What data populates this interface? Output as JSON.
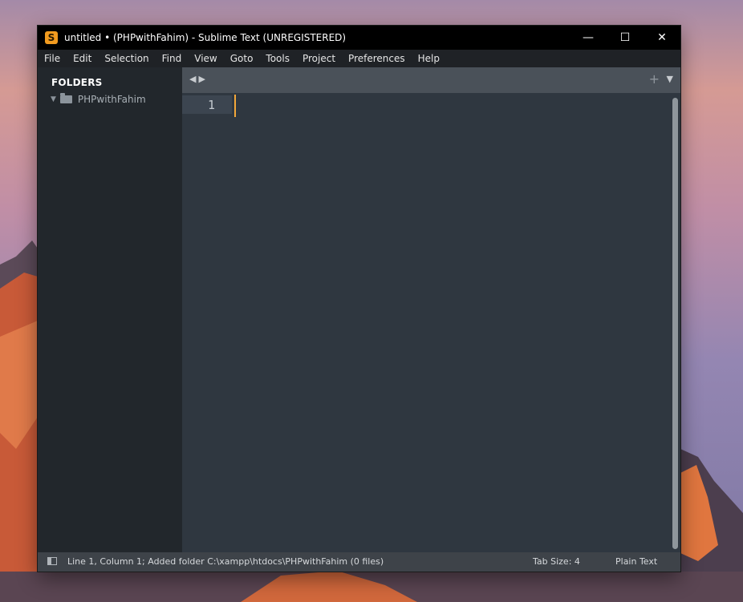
{
  "window": {
    "title": "untitled • (PHPwithFahim) - Sublime Text (UNREGISTERED)",
    "app_icon_glyph": "S",
    "controls": {
      "minimize": "—",
      "maximize": "☐",
      "close": "✕"
    }
  },
  "menubar": {
    "items": [
      "File",
      "Edit",
      "Selection",
      "Find",
      "View",
      "Goto",
      "Tools",
      "Project",
      "Preferences",
      "Help"
    ]
  },
  "sidebar": {
    "header": "FOLDERS",
    "folders": [
      {
        "name": "PHPwithFahim",
        "expanded": true
      }
    ]
  },
  "tabbar": {
    "nav_back": "◀",
    "nav_forward": "▶",
    "new_tab": "+",
    "dropdown": "▼"
  },
  "editor": {
    "line_numbers": [
      "1"
    ],
    "content": ""
  },
  "statusbar": {
    "message": "Line 1, Column 1; Added folder C:\\xampp\\htdocs\\PHPwithFahim (0 files)",
    "tab_size": "Tab Size: 4",
    "syntax": "Plain Text"
  },
  "colors": {
    "accent_caret": "#f3a73a",
    "app_icon": "#f29b1f",
    "editor_bg": "#2f3740",
    "sidebar_bg": "#22272c"
  }
}
